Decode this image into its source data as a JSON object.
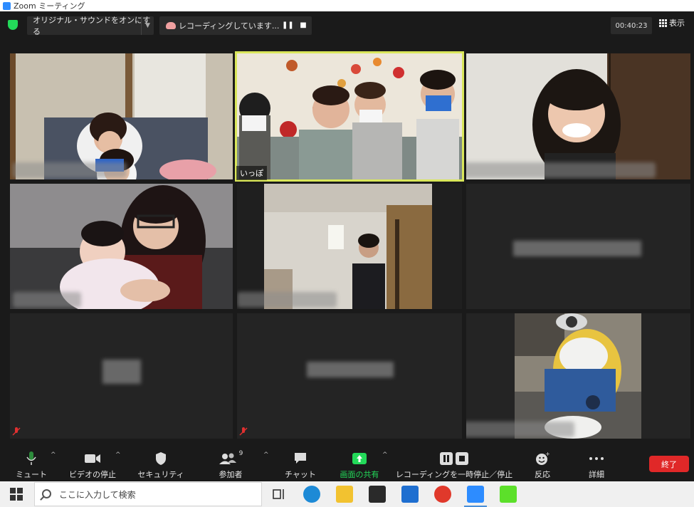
{
  "window": {
    "title": "Zoom ミーティング"
  },
  "topbar": {
    "sound_button": "オリジナル・サウンドをオンにする",
    "recording_status": "レコーディングしています...",
    "timer": "00:40:23",
    "view_label": "表示"
  },
  "tiles": {
    "active_speaker_name": "いっぽ"
  },
  "toolbar": {
    "mute": "ミュート",
    "video": "ビデオの停止",
    "security": "セキュリティ",
    "participants": "参加者",
    "participants_count": "9",
    "chat": "チャット",
    "share": "画面の共有",
    "record_pause": "レコーディングを一時停止／停止",
    "reactions": "反応",
    "more": "詳細",
    "end": "終了"
  },
  "taskbar": {
    "search_placeholder": "ここに入力して検索"
  },
  "colors": {
    "accent_green": "#23d959",
    "active_border": "#d9e65a",
    "end_red": "#e02828"
  }
}
